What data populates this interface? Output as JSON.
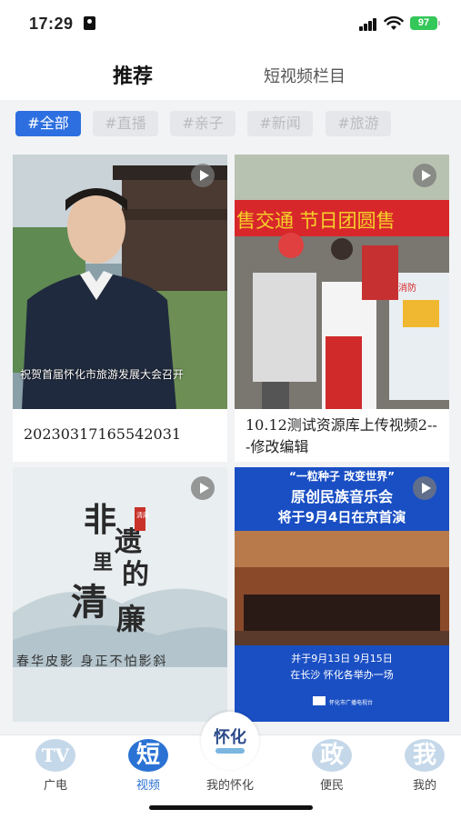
{
  "status_bar": {
    "time": "17:29",
    "battery": "97"
  },
  "top_tabs": [
    {
      "label": "推荐",
      "active": true
    },
    {
      "label": "短视频栏目",
      "active": false
    }
  ],
  "tags": [
    {
      "label": "#全部",
      "active": true
    },
    {
      "label": "#直播",
      "active": false
    },
    {
      "label": "#亲子",
      "active": false
    },
    {
      "label": "#新闻",
      "active": false
    },
    {
      "label": "#旅游",
      "active": false
    }
  ],
  "cards": [
    {
      "title": "20230317165542031",
      "caption": "祝贺首届怀化市旅游发展大会召开"
    },
    {
      "title": "10.12测试资源库上传视频2---修改编辑",
      "banner": "售交通 节日团圆售",
      "sign": "消防"
    },
    {
      "art_title": [
        "非",
        "遗",
        "里",
        "的",
        "清",
        "廉"
      ],
      "seal": "清廉",
      "caption": "春华皮影  身正不怕影斜"
    },
    {
      "banner_line1": "“一粒种子 改变世界”",
      "banner_line2": "原创民族音乐会",
      "banner_line3": "将于9月4日在京首演",
      "footer_line1": "并于9月13日 9月15日",
      "footer_line2": "在长沙 怀化各举办一场",
      "footer_logo": "怀化市广播电视台"
    }
  ],
  "bottom_nav": [
    {
      "icon": "TV",
      "label": "广电",
      "active": false
    },
    {
      "icon": "短",
      "label": "视频",
      "active": true
    },
    {
      "icon": "怀化",
      "label": "我的怀化",
      "active": false
    },
    {
      "icon": "政",
      "label": "便民",
      "active": false
    },
    {
      "icon": "我",
      "label": "我的",
      "active": false
    }
  ],
  "colors": {
    "accent": "#2d6fe0",
    "tag_bg": "#e6e7ea",
    "background": "#f2f3f5"
  }
}
